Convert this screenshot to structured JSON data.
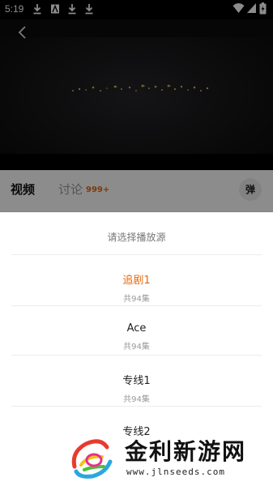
{
  "status_bar": {
    "time": "5:19",
    "left_icons": [
      "download-icon",
      "a-icon",
      "download-icon",
      "download-icon"
    ],
    "right_icons": [
      "wifi-icon",
      "signal-icon",
      "battery-icon"
    ]
  },
  "player": {
    "back_icon": "chevron-left-icon"
  },
  "tabs": {
    "video_label": "视频",
    "discuss_label": "讨论",
    "discuss_count": "999+",
    "danmu_label": "弹"
  },
  "sheet": {
    "title": "请选择播放源",
    "sources": [
      {
        "name": "追剧1",
        "count": "共94集",
        "active": true
      },
      {
        "name": "Ace",
        "count": "共94集",
        "active": false
      },
      {
        "name": "专线1",
        "count": "共94集",
        "active": false
      },
      {
        "name": "专线2",
        "count": "",
        "active": false
      }
    ]
  },
  "watermark": {
    "title": "金利新游网",
    "url": "www.jlnseeds.com"
  },
  "colors": {
    "accent": "#e8690f",
    "overlay": "rgba(0,0,0,0.45)"
  }
}
